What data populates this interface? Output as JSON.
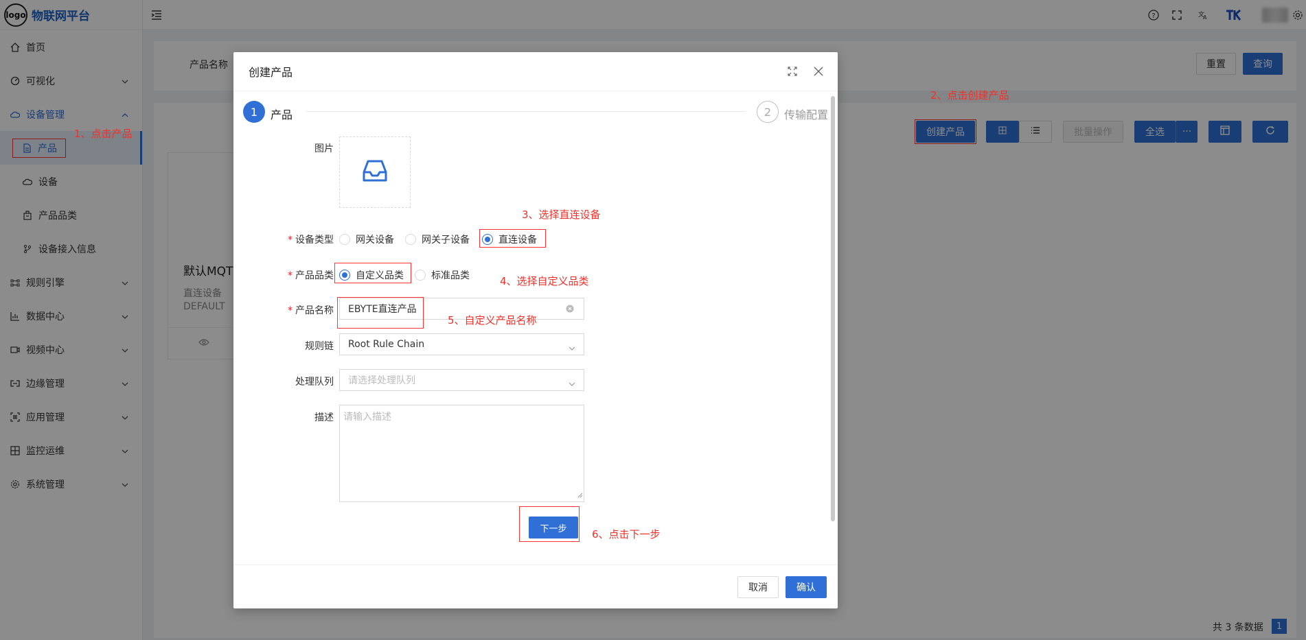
{
  "app": {
    "logo_text": "logo",
    "title": "物联网平台"
  },
  "sidebar": {
    "items": [
      {
        "label": "首页",
        "icon": "home-icon"
      },
      {
        "label": "可视化",
        "icon": "dashboard-icon"
      },
      {
        "label": "设备管理",
        "icon": "cloud-icon"
      },
      {
        "label": "产品",
        "icon": "file-icon"
      },
      {
        "label": "设备",
        "icon": "cloud-icon"
      },
      {
        "label": "产品品类",
        "icon": "category-icon"
      },
      {
        "label": "设备接入信息",
        "icon": "branch-icon"
      },
      {
        "label": "规则引擎",
        "icon": "rule-icon"
      },
      {
        "label": "数据中心",
        "icon": "chart-icon"
      },
      {
        "label": "视频中心",
        "icon": "video-icon"
      },
      {
        "label": "边缘管理",
        "icon": "edge-icon"
      },
      {
        "label": "应用管理",
        "icon": "app-icon"
      },
      {
        "label": "监控运维",
        "icon": "monitor-icon"
      },
      {
        "label": "系统管理",
        "icon": "settings-icon"
      }
    ]
  },
  "page": {
    "search": {
      "field_label": "产品名称",
      "reset_label": "重置",
      "query_label": "查询"
    },
    "toolbar": {
      "create_label": "创建产品",
      "batch_label": "批量操作",
      "select_all_label": "全选",
      "more_label": "···"
    },
    "card": {
      "title": "默认MQT",
      "type": "直连设备",
      "code": "DEFAULT"
    },
    "pagination": {
      "total": "共 3 条数据",
      "current": "1"
    }
  },
  "modal": {
    "title": "创建产品",
    "steps": [
      {
        "num": "1",
        "label": "产品"
      },
      {
        "num": "2",
        "label": "传输配置"
      }
    ],
    "form": {
      "image_label": "图片",
      "device_type_label": "设备类型",
      "device_type_options": [
        "网关设备",
        "网关子设备",
        "直连设备"
      ],
      "category_label": "产品品类",
      "category_options": [
        "自定义品类",
        "标准品类"
      ],
      "name_label": "产品名称",
      "name_value": "EBYTE直连产品",
      "rule_chain_label": "规则链",
      "rule_chain_value": "Root Rule Chain",
      "queue_label": "处理队列",
      "queue_placeholder": "请选择处理队列",
      "desc_label": "描述",
      "desc_placeholder": "请输入描述",
      "next_label": "下一步"
    },
    "footer": {
      "cancel_label": "取消",
      "ok_label": "确认"
    }
  },
  "annotations": {
    "a1": "1、点击产品",
    "a2": "2、点击创建产品",
    "a3": "3、选择直连设备",
    "a4": "4、选择自定义品类",
    "a5": "5、自定义产品名称",
    "a6": "6、点击下一步"
  },
  "colors": {
    "primary": "#2f6fd6",
    "annotation": "#f2302a",
    "brand": "#1a62c9"
  }
}
